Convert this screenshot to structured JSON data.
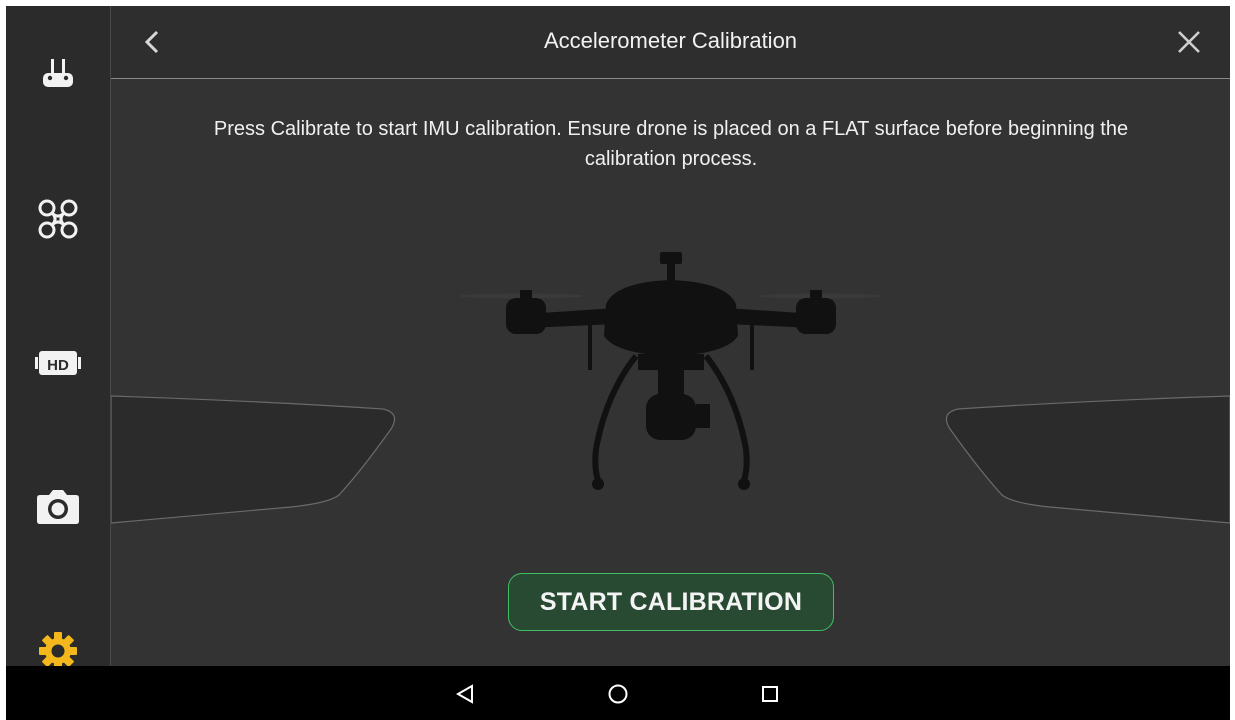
{
  "header": {
    "title": "Accelerometer Calibration",
    "back_icon": "chevron-left-icon",
    "close_icon": "close-icon"
  },
  "sidebar": {
    "items": [
      {
        "name": "remote-controller",
        "icon": "remote-controller-icon",
        "active": false
      },
      {
        "name": "aircraft",
        "icon": "drone-icon",
        "active": false
      },
      {
        "name": "hd-transmission",
        "icon": "hd-icon",
        "active": false
      },
      {
        "name": "camera",
        "icon": "camera-icon",
        "active": false
      },
      {
        "name": "settings",
        "icon": "gear-icon",
        "active": true
      }
    ]
  },
  "main": {
    "instructions": "Press Calibrate to start IMU calibration. Ensure drone is placed on a FLAT surface before beginning the calibration process.",
    "start_button_label": "START CALIBRATION"
  },
  "system_nav": {
    "back_icon": "nav-back-icon",
    "home_icon": "nav-home-icon",
    "recents_icon": "nav-recents-icon"
  },
  "colors": {
    "accent_active": "#f5b81c",
    "button_border": "#3fbf63",
    "button_fill": "#284a33",
    "background": "#333333",
    "sidebar": "#2b2b2b"
  }
}
